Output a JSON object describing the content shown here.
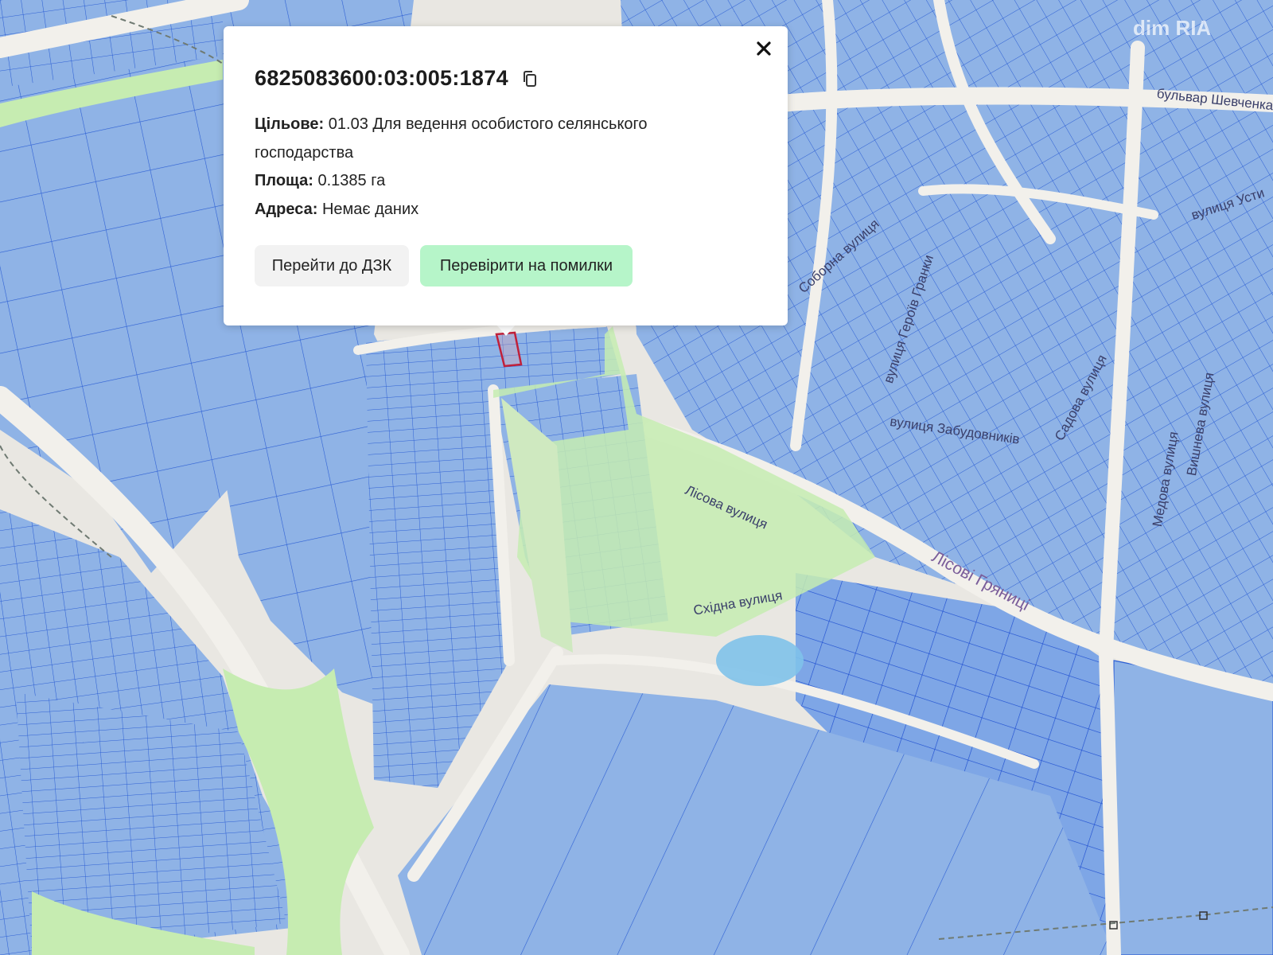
{
  "popup": {
    "parcel_id": "6825083600:03:005:1874",
    "purpose_label": "Цільове:",
    "purpose_value": "01.03 Для ведення особистого селянського господарства",
    "area_label": "Площа:",
    "area_value": "0.1385 га",
    "address_label": "Адреса:",
    "address_value": "Немає даних",
    "go_button": "Перейти до ДЗК",
    "check_button": "Перевірити на помилки",
    "close_icon": "close-icon",
    "copy_icon": "copy-icon"
  },
  "map": {
    "watermark": "dim RIA",
    "streets": [
      "бульвар Шевченка",
      "вулиця Усти",
      "Соборна вулиця",
      "вулиця Героїв Гранки",
      "вулиця Забудовників",
      "Садова вулиця",
      "Лісова вулиця",
      "Медова вулиця",
      "Вишнева вулиця",
      "Східна вулиця",
      "Лісові Гряниці"
    ],
    "colors": {
      "parcel_fill": "#8fb3e6",
      "parcel_stroke": "#1f4fd1",
      "park": "#c6ecb1",
      "road": "#f0eee9",
      "water": "#8ecbea",
      "selected": "#c0203a"
    }
  }
}
